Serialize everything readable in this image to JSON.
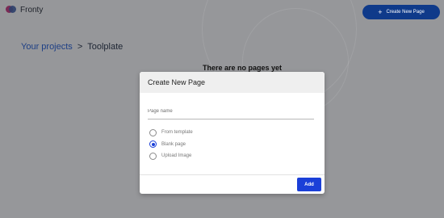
{
  "app": {
    "name": "Fronty"
  },
  "header": {
    "create_button_label": "Create New Page",
    "create_button_icon": "plus-icon"
  },
  "breadcrumb": {
    "parent": "Your projects",
    "separator": ">",
    "current": "Toolplate"
  },
  "main": {
    "empty_message": "There are no pages yet"
  },
  "modal": {
    "title": "Create New Page",
    "page_name_placeholder": "Page name",
    "options": [
      {
        "label": "From template",
        "selected": false
      },
      {
        "label": "Blank page",
        "selected": true
      },
      {
        "label": "Upload Image",
        "selected": false
      }
    ],
    "add_label": "Add"
  },
  "colors": {
    "accent": "#1a3fd8",
    "header_button": "#0f3a8a",
    "overlay": "#96979a"
  }
}
